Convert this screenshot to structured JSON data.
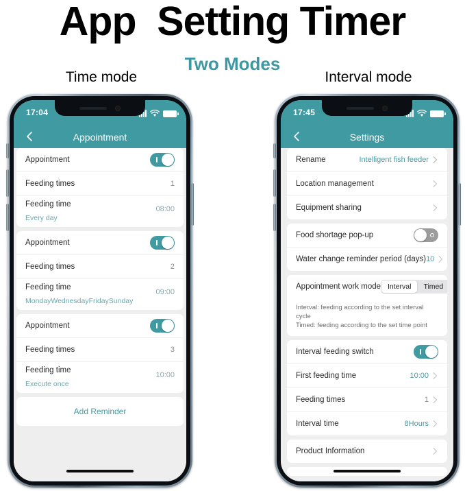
{
  "heading": {
    "title": "App  Setting Timer",
    "subtitle": "Two Modes",
    "subtitle_color": "#3e98a2",
    "left_mode_label": "Time mode",
    "right_mode_label": "Interval mode"
  },
  "theme": {
    "accent_teal": "#3f9aa2",
    "link_teal": "#4c9aa2",
    "toggle_off_grey": "#9c9c9c",
    "screen_bg": "#eeeeee"
  },
  "left_phone": {
    "status_bar": {
      "time": "17:04",
      "signal_icon": "signal-bars-icon",
      "wifi_icon": "wifi-icon",
      "battery_icon": "battery-full-icon"
    },
    "nav": {
      "back_icon": "chevron-left-icon",
      "title": "Appointment"
    },
    "groups": [
      {
        "toggle_label": "Appointment",
        "toggle_state": "on",
        "feeding_times_label": "Feeding times",
        "feeding_times_value": "1",
        "feeding_time_label": "Feeding time",
        "feeding_time_value": "08:00",
        "repeat": "Every day"
      },
      {
        "toggle_label": "Appointment",
        "toggle_state": "on",
        "feeding_times_label": "Feeding times",
        "feeding_times_value": "2",
        "feeding_time_label": "Feeding time",
        "feeding_time_value": "09:00",
        "repeat": "MondayWednesdayFridaySunday"
      },
      {
        "toggle_label": "Appointment",
        "toggle_state": "on",
        "feeding_times_label": "Feeding times",
        "feeding_times_value": "3",
        "feeding_time_label": "Feeding time",
        "feeding_time_value": "10:00",
        "repeat": "Execute once"
      }
    ],
    "add_reminder_label": "Add Reminder"
  },
  "right_phone": {
    "status_bar": {
      "time": "17:45",
      "signal_icon": "signal-bars-icon",
      "wifi_icon": "wifi-icon",
      "battery_icon": "battery-full-icon"
    },
    "nav": {
      "back_icon": "chevron-left-icon",
      "title": "Settings"
    },
    "group1": [
      {
        "label": "Rename",
        "value": "Intelligent fish feeder",
        "chevron": true
      },
      {
        "label": "Location management",
        "value": "",
        "chevron": true
      },
      {
        "label": "Equipment sharing",
        "value": "",
        "chevron": true
      }
    ],
    "group2": {
      "food_shortage_label": "Food shortage pop-up",
      "food_shortage_state": "off",
      "water_change_label": "Water change reminder period (days)",
      "water_change_value": "10"
    },
    "work_mode": {
      "label": "Appointment work mode",
      "options": [
        "Interval",
        "Timed"
      ],
      "selected": "Interval",
      "description_line1": "Interval: feeding according to the set interval cycle",
      "description_line2": "Timed: feeding according to the set time point"
    },
    "group3": {
      "interval_switch_label": "Interval feeding switch",
      "interval_switch_state": "on",
      "first_feeding_label": "First feeding time",
      "first_feeding_value": "10:00",
      "feeding_times_label": "Feeding times",
      "feeding_times_value": "1",
      "interval_time_label": "Interval time",
      "interval_time_value": "8Hours"
    },
    "group4": {
      "product_info_label": "Product Information"
    }
  }
}
